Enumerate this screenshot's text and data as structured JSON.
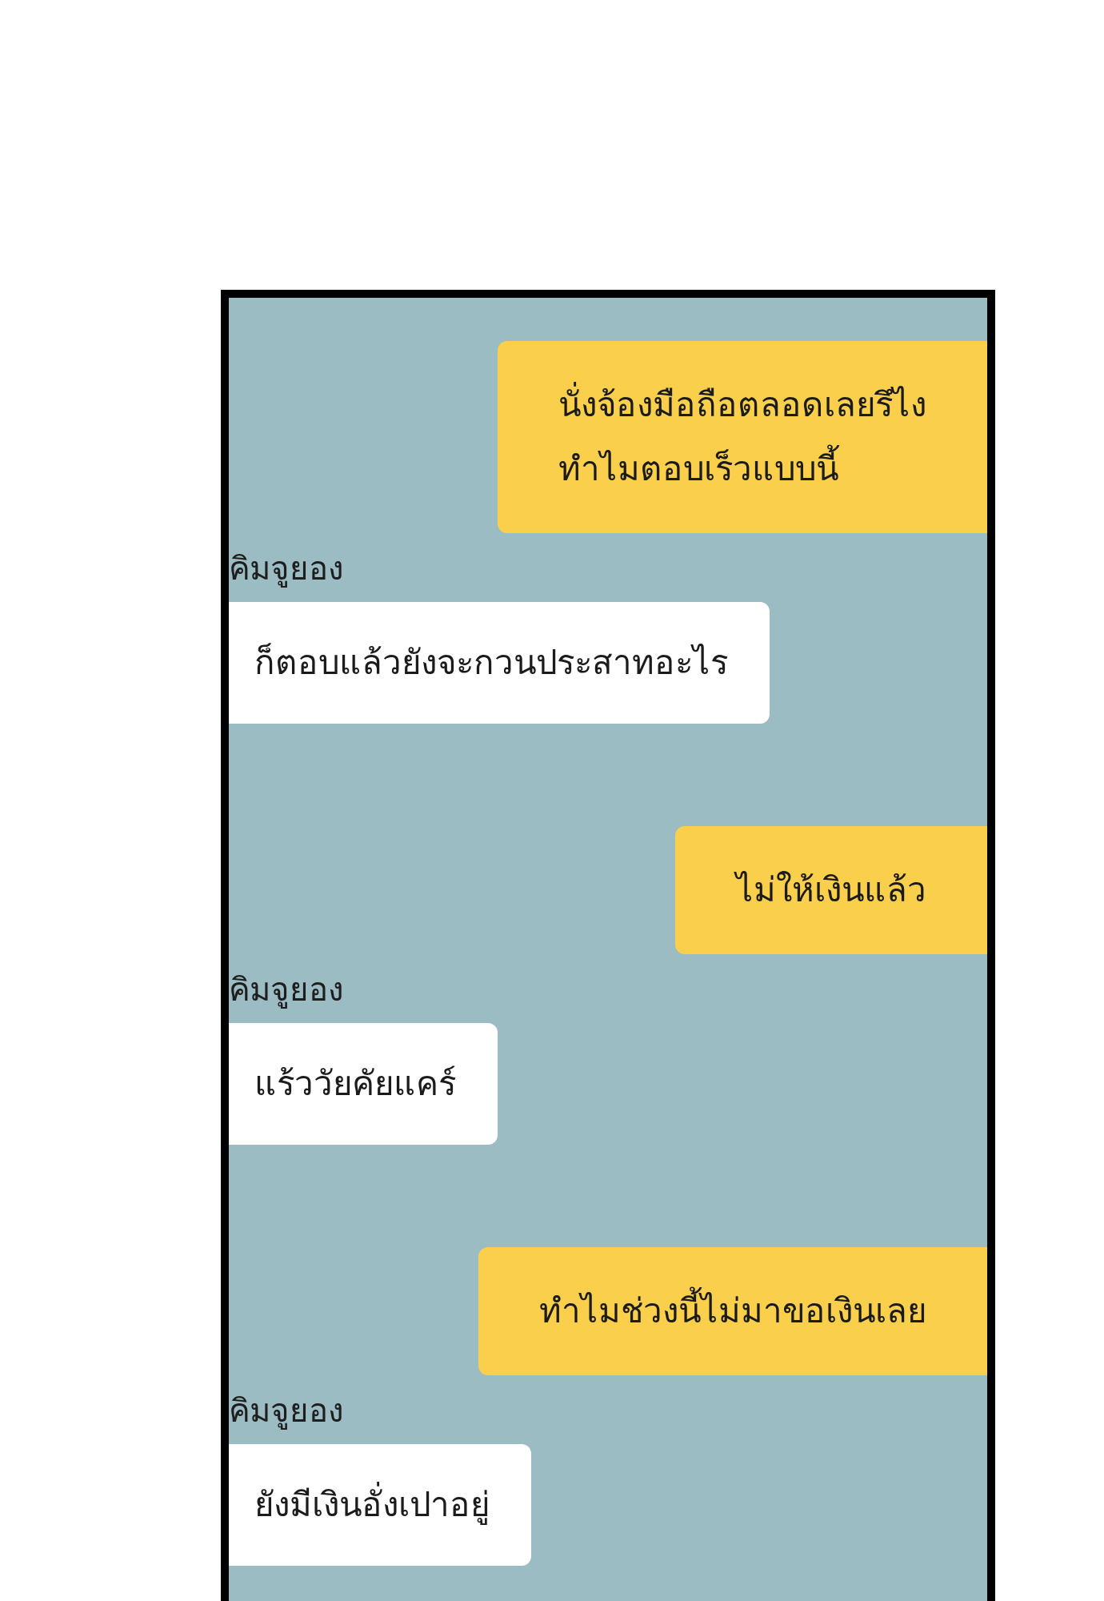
{
  "messages": [
    {
      "kind": "sent",
      "text": "นั่งจ้องมือถือตลอดเลยรึไง\nทำไมตอบเร็วแบบนี้"
    },
    {
      "kind": "received",
      "sender": "คิมจูยอง",
      "text": "ก็ตอบแล้วยังจะกวนประสาทอะไร"
    },
    {
      "kind": "sent",
      "text": "ไม่ให้เงินแล้ว"
    },
    {
      "kind": "received",
      "sender": "คิมจูยอง",
      "text": "แร้ววัยคัยแคร์"
    },
    {
      "kind": "sent",
      "text": "ทำไมช่วงนี้ไม่มาขอเงินเลย"
    },
    {
      "kind": "received",
      "sender": "คิมจูยอง",
      "text": "ยังมีเงินอั่งเปาอยู่"
    }
  ]
}
